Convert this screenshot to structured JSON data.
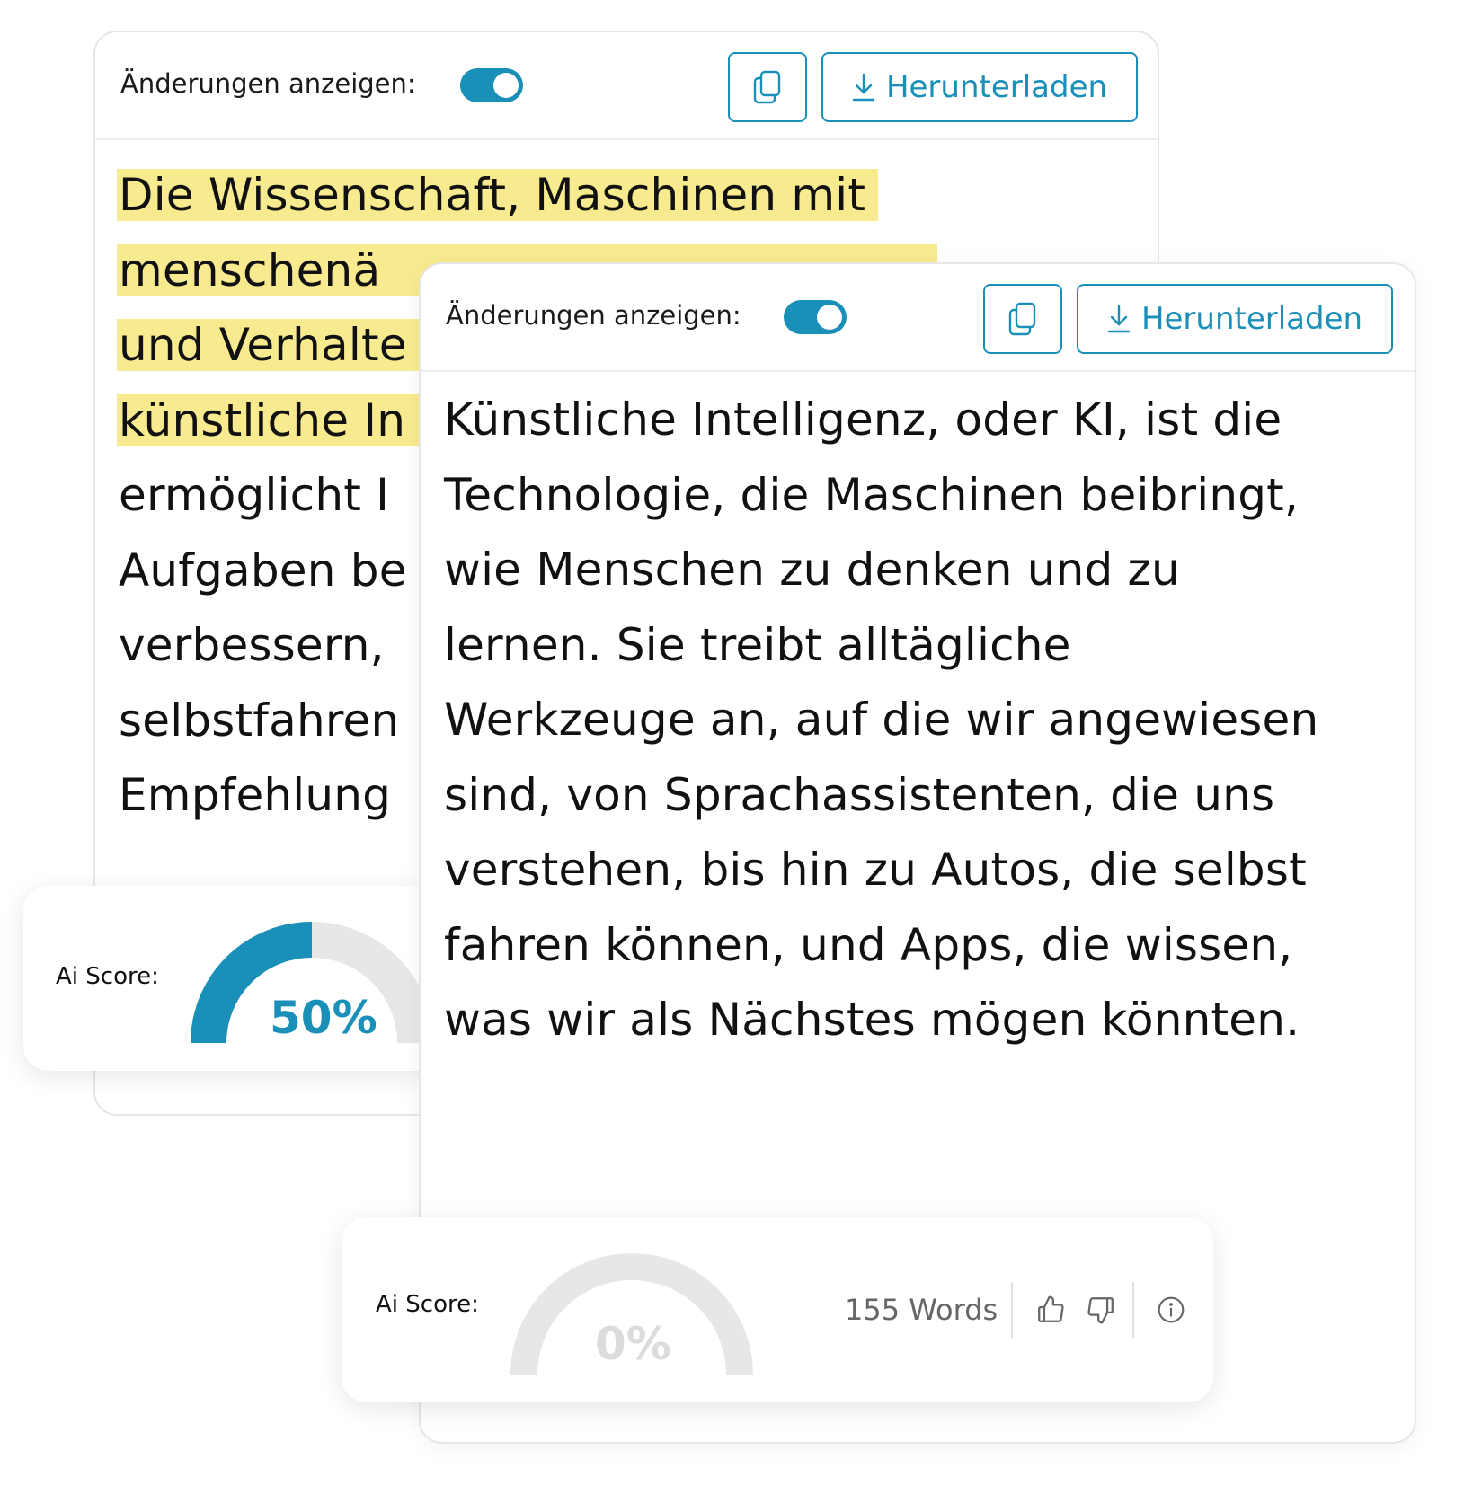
{
  "colors": {
    "accent": "#1a8fb8",
    "highlight": "#f8ea8e",
    "gauge_track": "#e7e7e7",
    "muted_value": "#dcdcdc"
  },
  "original_panel": {
    "toggle_label": "Änderungen anzeigen:",
    "toggle_on": true,
    "copy_icon": "copy-icon",
    "download_icon": "download-icon",
    "download_label": "Herunterladen",
    "lines": [
      {
        "text": "Die Wissenschaft, Maschinen mit",
        "highlighted": true
      },
      {
        "text": "menschenä",
        "highlighted": true
      },
      {
        "text": "und Verhalte",
        "highlighted": true
      },
      {
        "text": "künstliche In",
        "highlighted": true
      },
      {
        "text": "ermöglicht I",
        "highlighted": false
      },
      {
        "text": "Aufgaben be",
        "highlighted": false
      },
      {
        "text": "verbessern,",
        "highlighted": false
      },
      {
        "text": "selbstfahren",
        "highlighted": false
      },
      {
        "text": "Empfehlung",
        "highlighted": false
      }
    ]
  },
  "original_score": {
    "label": "Ai Score:",
    "value_text": "50%",
    "value": 50
  },
  "rewritten_panel": {
    "toggle_label": "Änderungen anzeigen:",
    "toggle_on": true,
    "copy_icon": "copy-icon",
    "download_icon": "download-icon",
    "download_label": "Herunterladen",
    "lines": [
      "Künstliche Intelligenz, oder KI, ist die",
      "Technologie, die Maschinen beibringt,",
      "wie Menschen zu denken und zu",
      "lernen. Sie treibt alltägliche",
      "Werkzeuge an, auf die wir angewiesen",
      "sind, von Sprachassistenten, die uns",
      "verstehen, bis hin zu Autos, die selbst",
      "fahren können, und Apps, die wissen,",
      "was wir als Nächstes mögen könnten."
    ]
  },
  "rewritten_score": {
    "label": "Ai Score:",
    "value_text": "0%",
    "value": 0,
    "word_count": "155 Words",
    "like_icon": "thumbs-up-icon",
    "dislike_icon": "thumbs-down-icon",
    "info_icon": "info-icon"
  }
}
